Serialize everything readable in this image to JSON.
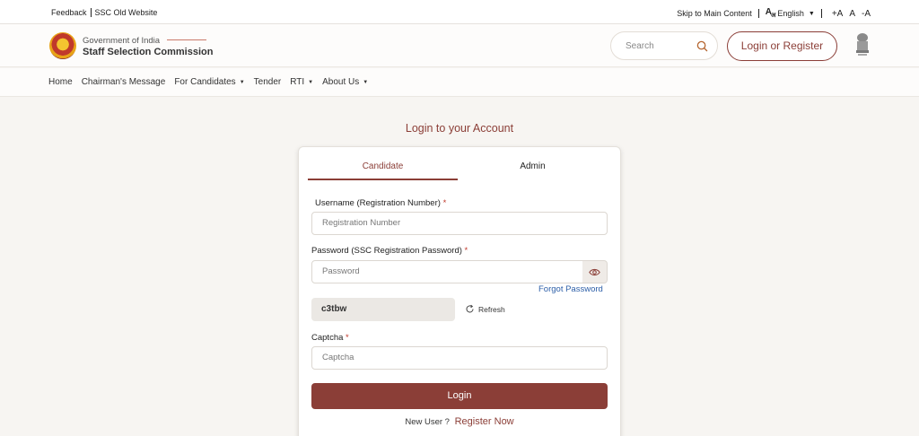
{
  "topbar": {
    "feedback": "Feedback",
    "old_website": "SSC Old Website",
    "skip": "Skip to Main Content",
    "language": "English",
    "font_increase": "+A",
    "font_normal": "A",
    "font_decrease": "-A"
  },
  "header": {
    "gov": "Government of India",
    "org": "Staff Selection Commission",
    "search_placeholder": "Search",
    "login_register": "Login or Register"
  },
  "nav": {
    "home": "Home",
    "chairman": "Chairman's Message",
    "candidates": "For Candidates",
    "tender": "Tender",
    "rti": "RTI",
    "about": "About Us"
  },
  "main": {
    "title": "Login to your Account",
    "tabs": {
      "candidate": "Candidate",
      "admin": "Admin"
    },
    "username_label": "Username (Registration Number)",
    "username_placeholder": "Registration Number",
    "password_label": "Password (SSC Registration Password)",
    "password_placeholder": "Password",
    "forgot": "Forgot Password",
    "captcha_code": "c3tbw",
    "refresh": "Refresh",
    "captcha_label": "Captcha",
    "captcha_placeholder": "Captcha",
    "required_mark": "*",
    "login_button": "Login",
    "new_user": "New User ?",
    "register_now": "Register Now"
  },
  "colors": {
    "primary": "#8b3e37",
    "link": "#2d5fa8",
    "required": "#c0392b"
  }
}
